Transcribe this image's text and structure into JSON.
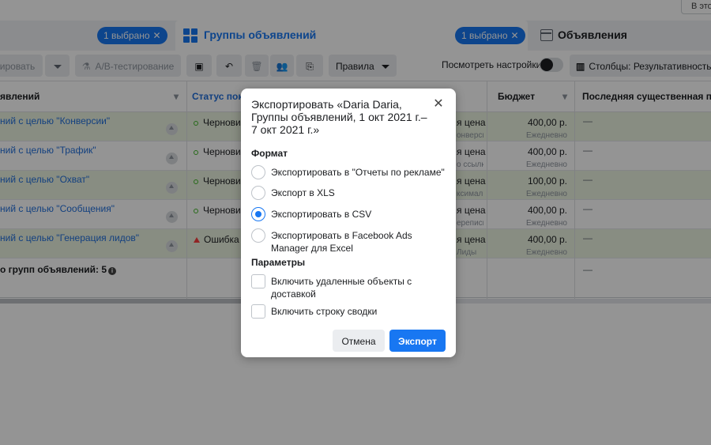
{
  "top": {
    "search_text": "В это"
  },
  "tabs": {
    "campaigns_badge": "1 выбрано",
    "adsets_badge": "1 выбрано",
    "adsets_label": "Группы объявлений",
    "ads_label": "Объявления",
    "close_glyph": "✕"
  },
  "toolbar": {
    "edit_label": "ировать",
    "ab_test_label": "A/B-тестирование",
    "rules_label": "Правила",
    "view_settings_label": "Посмотреть настройки",
    "columns_label": "Столбцы: Результативность"
  },
  "table": {
    "headers": {
      "name": "явлений",
      "status": "Статус пока",
      "budget": "Бюджет",
      "last_edit": "Последняя существенная пра"
    },
    "rows": [
      {
        "name": "ний с целью \"Конверсии\"",
        "status": "Чернови",
        "status_type": "draft",
        "bid": "я цена",
        "bid_sub": "онверсии",
        "budget": "400,00 р.",
        "budget_sub": "Ежедневно",
        "last": "—"
      },
      {
        "name": "ний с целью \"Трафик\"",
        "status": "Чернови",
        "status_type": "draft",
        "bid": "я цена",
        "bid_sub": "о ссылке",
        "budget": "400,00 р.",
        "budget_sub": "Ежедневно",
        "last": "—"
      },
      {
        "name": "ний с целью \"Охват\"",
        "status": "Чернови",
        "status_type": "draft",
        "bid": "я цена",
        "bid_sub": "ксимальн...",
        "budget": "100,00 р.",
        "budget_sub": "Ежедневно",
        "last": "—"
      },
      {
        "name": "ний с целью \"Сообщения\"",
        "status": "Чернови",
        "status_type": "draft",
        "bid": "я цена",
        "bid_sub": "ереписки",
        "budget": "400,00 р.",
        "budget_sub": "Ежедневно",
        "last": "—"
      },
      {
        "name": "ний с целью \"Генерация лидов\"",
        "status": "Ошибка н",
        "status_type": "error",
        "bid": "я цена",
        "bid_sub": "Лиды",
        "budget": "400,00 р.",
        "budget_sub": "Ежедневно",
        "last": "—"
      }
    ],
    "total_label": "о групп объявлений: 5",
    "total_last": "—"
  },
  "modal": {
    "title": "Экспортировать «Daria Daria, Группы объявлений, 1 окт 2021 г.–7 окт 2021 г.»",
    "close_glyph": "✕",
    "format_label": "Формат",
    "options": [
      {
        "label": "Экспортировать в \"Отчеты по рекламе\"",
        "selected": false
      },
      {
        "label": "Экспорт в XLS",
        "selected": false
      },
      {
        "label": "Экспортировать в CSV",
        "selected": true
      },
      {
        "label": "Экспортировать в Facebook Ads Manager для Excel",
        "selected": false
      }
    ],
    "params_label": "Параметры",
    "checkboxes": [
      {
        "label": "Включить удаленные объекты с доставкой",
        "checked": false
      },
      {
        "label": "Включить строку сводки",
        "checked": false
      }
    ],
    "cancel_label": "Отмена",
    "export_label": "Экспорт"
  }
}
